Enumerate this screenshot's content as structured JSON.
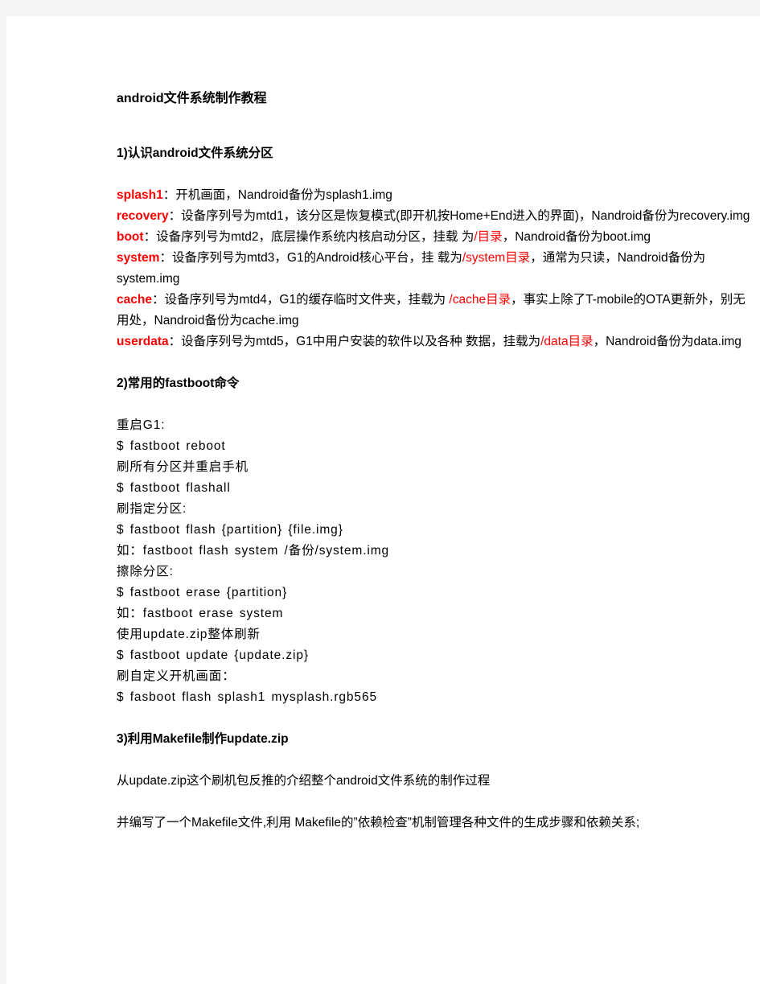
{
  "document": {
    "title": "android文件系统制作教程",
    "sections": [
      {
        "heading": "1)认识android文件系统分区",
        "partitions": [
          {
            "name": "splash1",
            "sep": "：",
            "desc_before": "开机画面，Nandroid备份为splash1.img",
            "path": "",
            "desc_after": ""
          },
          {
            "name": "recovery",
            "sep": "：",
            "desc_before": "设备序列号为mtd1，该分区是恢复模式(即开机按Home+End进入的界面)，Nandroid备份为recovery.img",
            "path": "",
            "desc_after": ""
          },
          {
            "name": "boot",
            "sep": "：",
            "desc_before": "设备序列号为mtd2，底层操作系统内核启动分区，挂载 为",
            "path": "/目录",
            "desc_after": "，Nandroid备份为boot.img"
          },
          {
            "name": "system",
            "sep": "：",
            "desc_before": "设备序列号为mtd3，G1的Android核心平台，挂 载为",
            "path": "/system目录",
            "desc_after": "，通常为只读，Nandroid备份为system.img"
          },
          {
            "name": "cache",
            "sep": "：",
            "desc_before": "设备序列号为mtd4，G1的缓存临时文件夹，挂载为 ",
            "path": "/cache目录",
            "desc_after": "，事实上除了T-mobile的OTA更新外，别无用处，Nandroid备份为cache.img"
          },
          {
            "name": "userdata",
            "sep": "：",
            "desc_before": "设备序列号为mtd5，G1中用户安装的软件以及各种 数据，挂载为",
            "path": "/data目录",
            "desc_after": "，Nandroid备份为data.img"
          }
        ]
      },
      {
        "heading": "2)常用的fastboot命令",
        "lines": [
          "重启G1:",
          "$ fastboot reboot",
          "刷所有分区并重启手机",
          "$ fastboot flashall",
          "刷指定分区:",
          "$ fastboot flash {partition} {file.img}",
          "如：fastboot flash system /备份/system.img",
          "擦除分区:",
          "$ fastboot erase {partition}",
          "如：fastboot erase system",
          "使用update.zip整体刷新",
          "$ fastboot update {update.zip}",
          "刷自定义开机画面：",
          "$ fasboot flash splash1 mysplash.rgb565"
        ]
      },
      {
        "heading": "3)利用Makefile制作update.zip",
        "paragraphs": [
          "从update.zip这个刷机包反推的介绍整个android文件系统的制作过程",
          "并编写了一个Makefile文件,利用 Makefile的”依赖检查”机制管理各种文件的生成步骤和依赖关系;"
        ]
      }
    ]
  },
  "colors": {
    "accent_red": "#ff0000",
    "text": "#000000",
    "page_background": "#ffffff",
    "canvas_background": "#f4f4f4"
  }
}
